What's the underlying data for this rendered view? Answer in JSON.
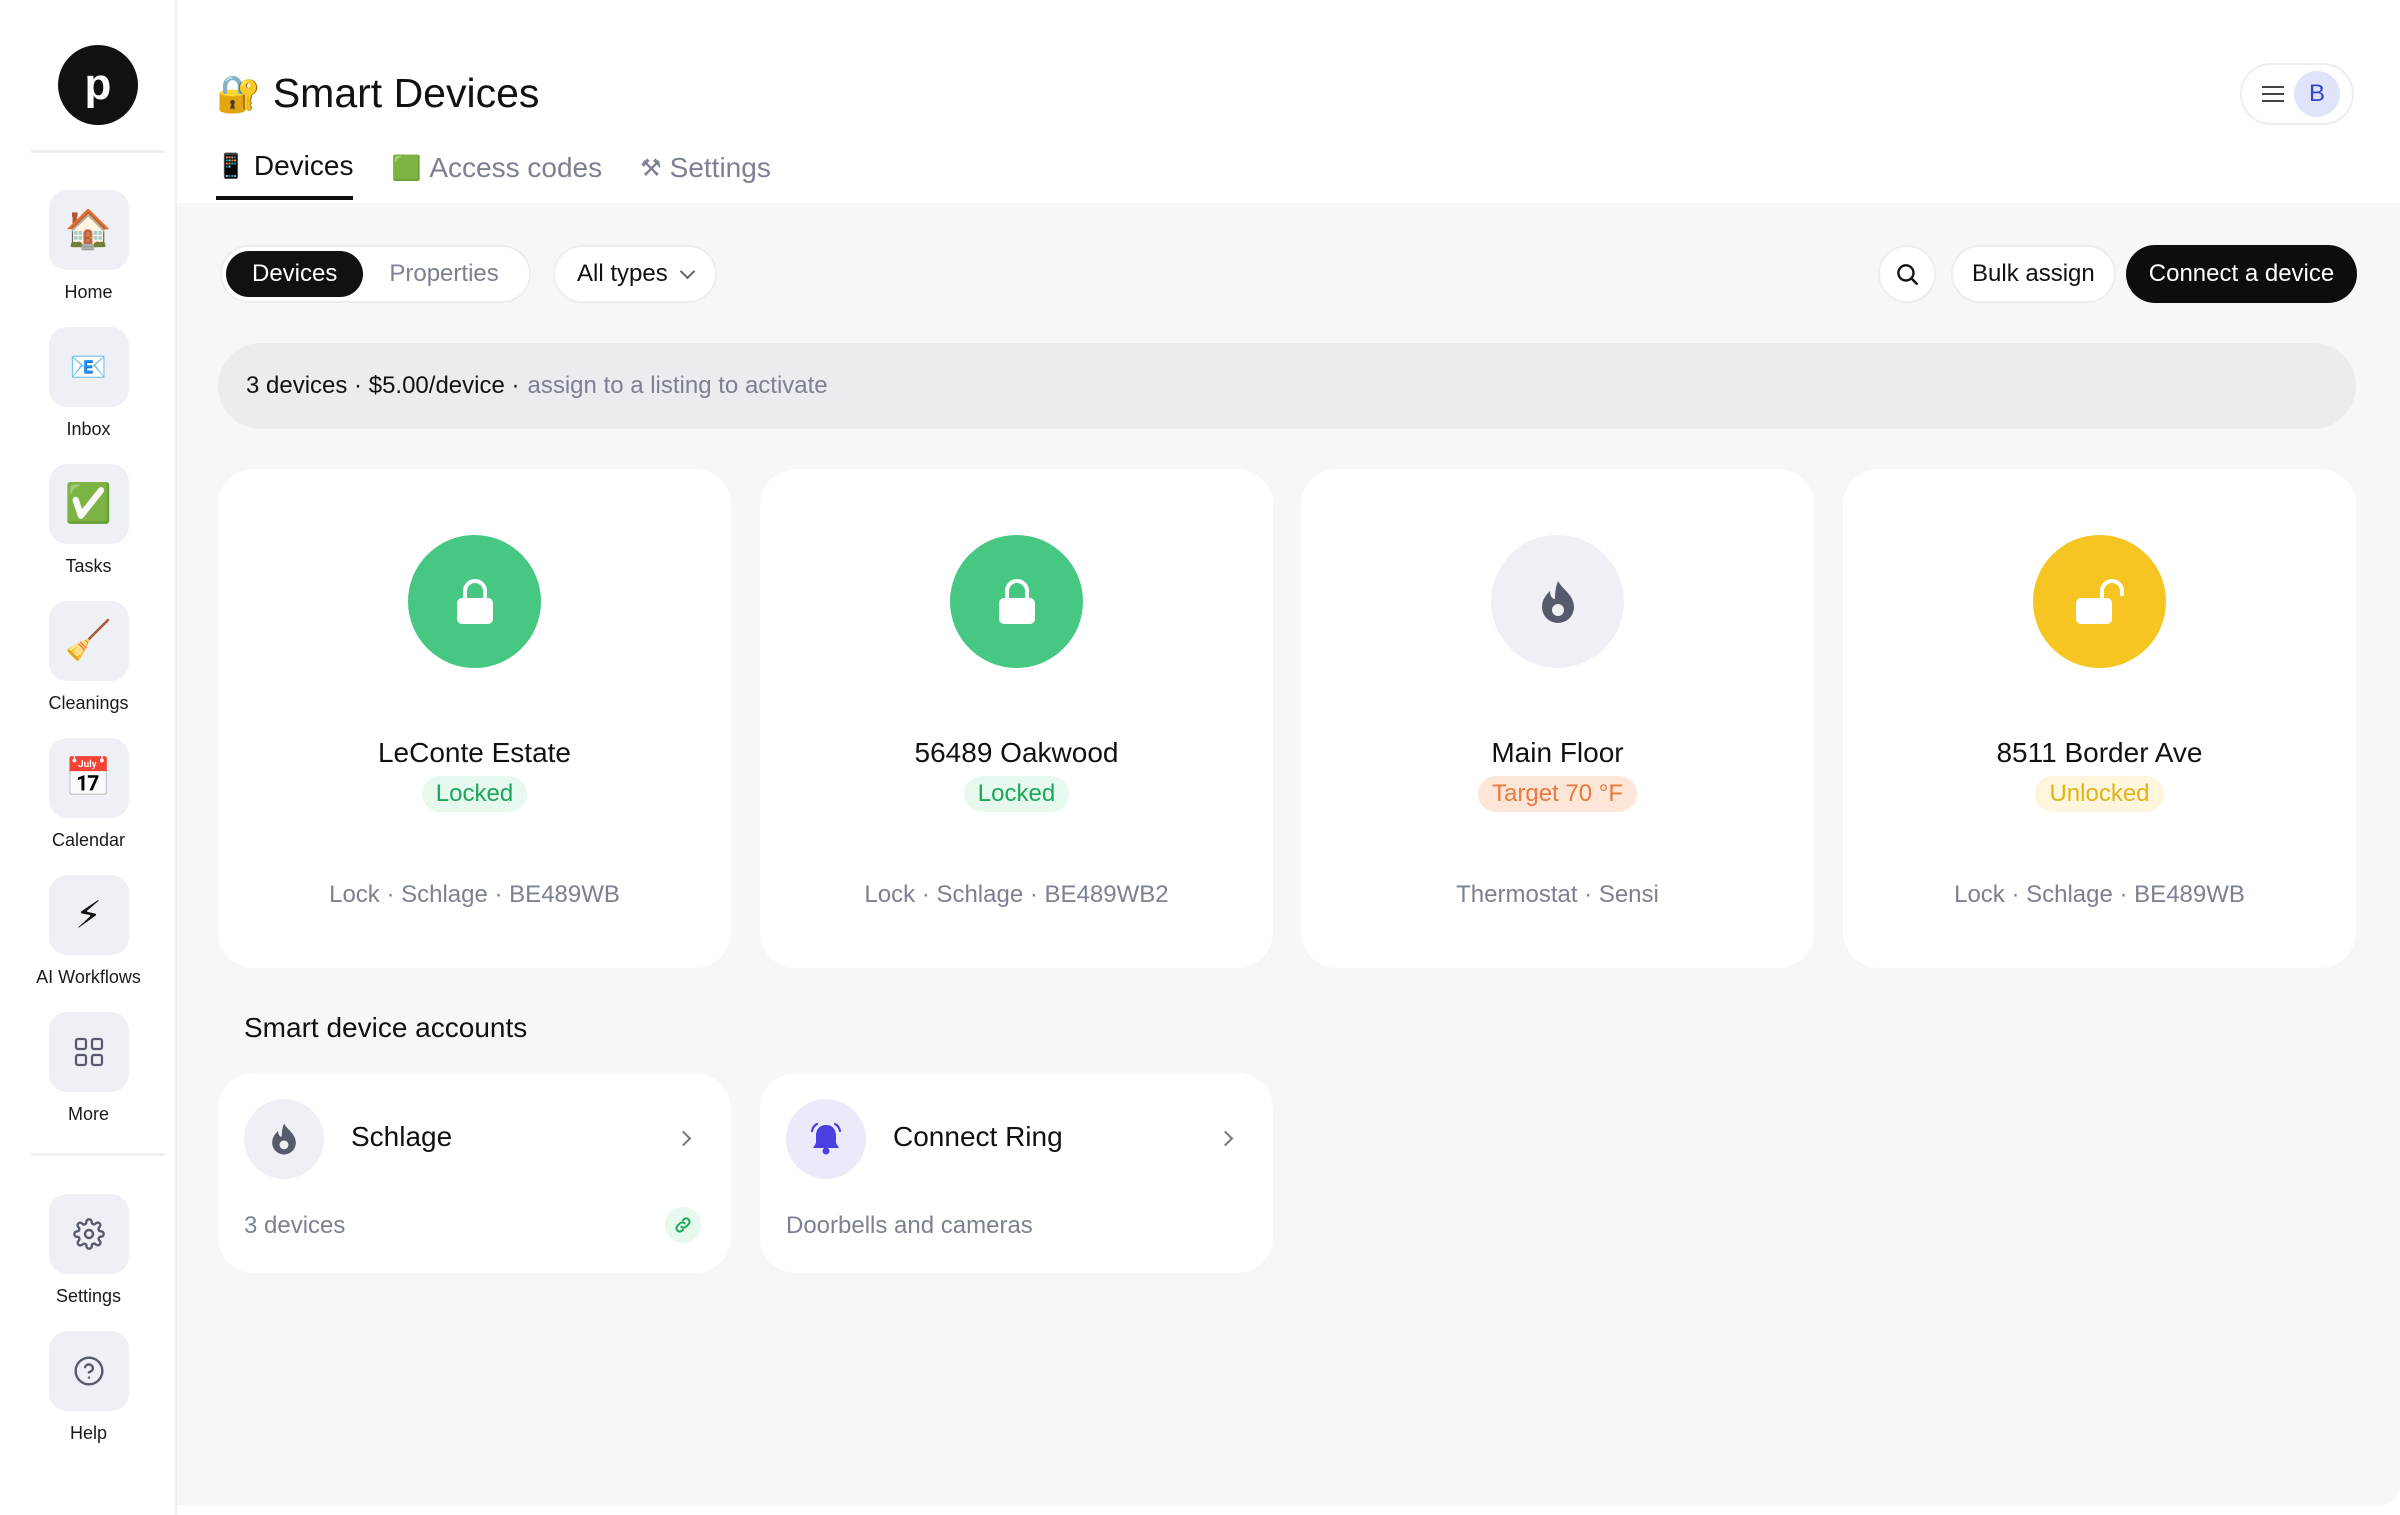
{
  "app": {
    "logo_letter": "p"
  },
  "sidebar": {
    "items": [
      {
        "label": "Home",
        "icon": "🏠",
        "icon_name": "home-icon"
      },
      {
        "label": "Inbox",
        "icon": "📧",
        "icon_name": "inbox-icon"
      },
      {
        "label": "Tasks",
        "icon": "✅",
        "icon_name": "tasks-icon"
      },
      {
        "label": "Cleanings",
        "icon": "🧹",
        "icon_name": "broom-icon"
      },
      {
        "label": "Calendar",
        "icon": "📅",
        "icon_name": "calendar-icon"
      },
      {
        "label": "AI Workflows",
        "icon": "⚡",
        "icon_name": "lightning-icon"
      },
      {
        "label": "More",
        "icon_name": "grid-icon"
      },
      {
        "label": "Settings",
        "icon_name": "gear-icon"
      },
      {
        "label": "Help",
        "icon_name": "help-icon"
      }
    ]
  },
  "header": {
    "title_emoji": "🔐",
    "title": "Smart Devices",
    "avatar_letter": "B"
  },
  "tabs": [
    {
      "icon": "📱",
      "label": "Devices",
      "active": true
    },
    {
      "icon": "🟩",
      "label": "Access codes",
      "active": false
    },
    {
      "icon": "⚒",
      "label": "Settings",
      "active": false
    }
  ],
  "toolbar": {
    "segments": [
      "Devices",
      "Properties"
    ],
    "active_segment": "Devices",
    "type_filter": "All types",
    "bulk_assign": "Bulk assign",
    "connect_device": "Connect a device"
  },
  "banner": {
    "main": "3 devices · $5.00/device ·",
    "muted": "assign to a listing to activate"
  },
  "devices": [
    {
      "name": "LeConte Estate",
      "status": "Locked",
      "status_kind": "green",
      "meta": "Lock · Schlage · BE489WB",
      "icon_name": "lock-closed-icon",
      "circle_color": "#46c883"
    },
    {
      "name": "56489 Oakwood",
      "status": "Locked",
      "status_kind": "green",
      "meta": "Lock · Schlage · BE489WB2",
      "icon_name": "lock-closed-icon",
      "circle_color": "#46c883"
    },
    {
      "name": "Main Floor",
      "status": "Target 70 °F",
      "status_kind": "orange",
      "meta": "Thermostat · Sensi",
      "icon_name": "flame-icon",
      "circle_color": "#eef0f5"
    },
    {
      "name": "8511 Border Ave",
      "status": "Unlocked",
      "status_kind": "yellow",
      "meta": "Lock · Schlage · BE489WB",
      "icon_name": "lock-open-icon",
      "circle_color": "#f6c521"
    }
  ],
  "accounts_section": {
    "title": "Smart device accounts"
  },
  "accounts": [
    {
      "name": "Schlage",
      "sub": "3 devices",
      "icon_name": "flame-icon",
      "linked": true
    },
    {
      "name": "Connect Ring",
      "sub": "Doorbells and cameras",
      "icon_name": "bell-icon",
      "linked": false
    }
  ],
  "colors": {
    "accent": "#111111",
    "green": "#46c883",
    "yellow": "#f6c521",
    "ring_purple": "#4a3fe0"
  }
}
